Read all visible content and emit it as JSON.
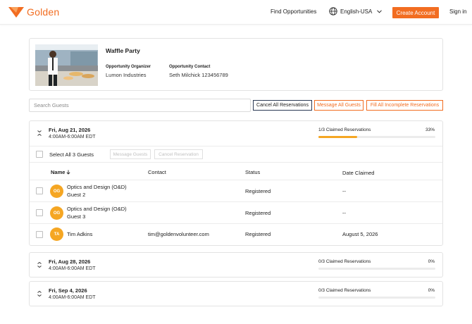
{
  "header": {
    "logo_text": "Golden",
    "find_opportunities": "Find Opportunities",
    "language": "English-USA",
    "create_account": "Create Account",
    "sign_in": "Sign in",
    "brand_color": "#f26d21"
  },
  "opportunity": {
    "title": "Waffle Party",
    "organizer_label": "Opportunity Organizer",
    "organizer": "Lumon Industries",
    "contact_label": "Opportunity Contact",
    "contact": "Seth Milchick 123456789"
  },
  "toolbar": {
    "search_placeholder": "Search Guests",
    "cancel_all": "Cancel All Reservations",
    "message_all": "Message All Guests",
    "fill_all": "Fill All Incomplete Reservations"
  },
  "dates": [
    {
      "date": "Fri, Aug 21, 2026",
      "time": "4:00AM-6:00AM EDT",
      "claimed": "1/3 Claimed Reservations",
      "percent": "33%",
      "progress": 0.33,
      "select_all": "Select All 3 Guests",
      "message_guests": "Message Guests",
      "cancel_reservation": "Cancel Reservation",
      "columns": {
        "name": "Name",
        "contact": "Contact",
        "status": "Status",
        "date_claimed": "Date Claimed"
      },
      "rows": [
        {
          "initials": "OG",
          "name": "Optics and Design (O&D)",
          "sub": "Guest 2",
          "contact": "",
          "status": "Registered",
          "date_claimed": "--"
        },
        {
          "initials": "OG",
          "name": "Optics and Design (O&D)",
          "sub": "Guest 3",
          "contact": "",
          "status": "Registered",
          "date_claimed": "--"
        },
        {
          "initials": "TA",
          "name": "Tim Adkins",
          "sub": "",
          "contact": "tim@goldenvolunteer.com",
          "status": "Registered",
          "date_claimed": "August 5, 2026"
        }
      ]
    },
    {
      "date": "Fri, Aug 28, 2026",
      "time": "4:00AM-6:00AM EDT",
      "claimed": "0/3 Claimed Reservations",
      "percent": "0%",
      "progress": 0
    },
    {
      "date": "Fri, Sep 4, 2026",
      "time": "4:00AM-6:00AM EDT",
      "claimed": "0/3 Claimed Reservations",
      "percent": "0%",
      "progress": 0
    }
  ]
}
